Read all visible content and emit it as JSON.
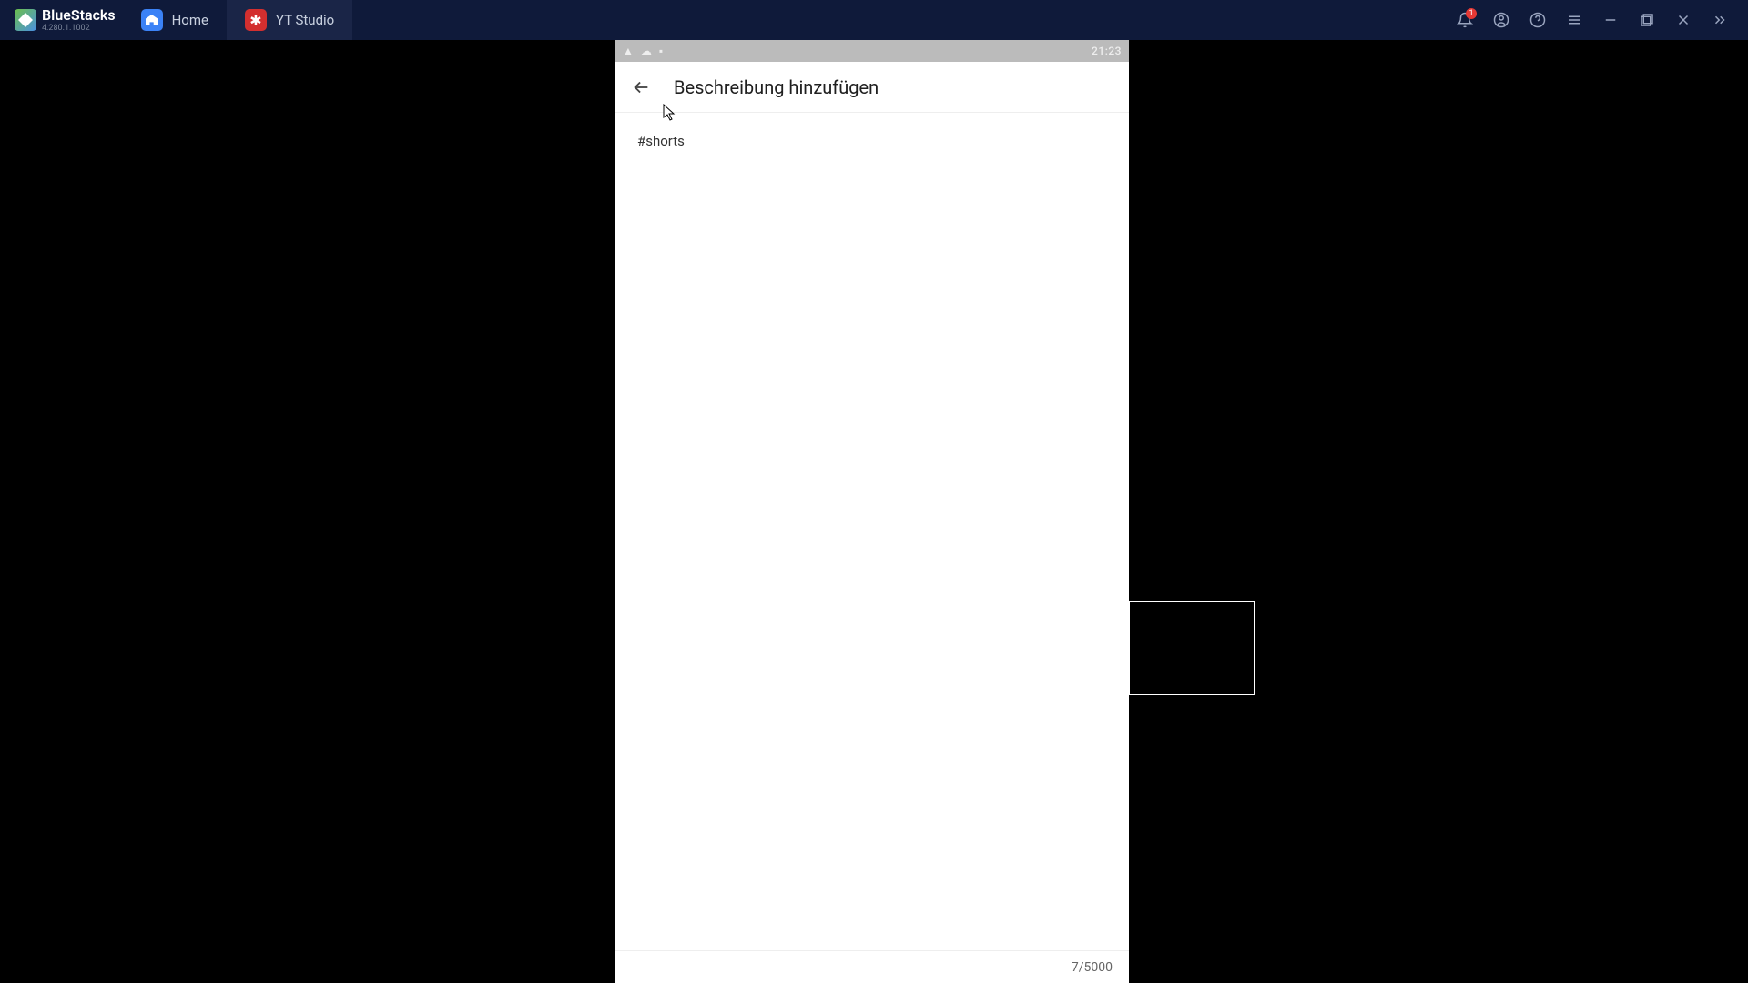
{
  "bluestacks": {
    "name": "BlueStacks",
    "version": "4.280.1.1002"
  },
  "tabs": [
    {
      "label": "Home"
    },
    {
      "label": "YT Studio"
    }
  ],
  "titlebar": {
    "notif_count": "1"
  },
  "android": {
    "time": "21:23"
  },
  "app": {
    "header_title": "Beschreibung hinzufügen",
    "description_text": "#shorts",
    "char_counter": "7/5000"
  }
}
